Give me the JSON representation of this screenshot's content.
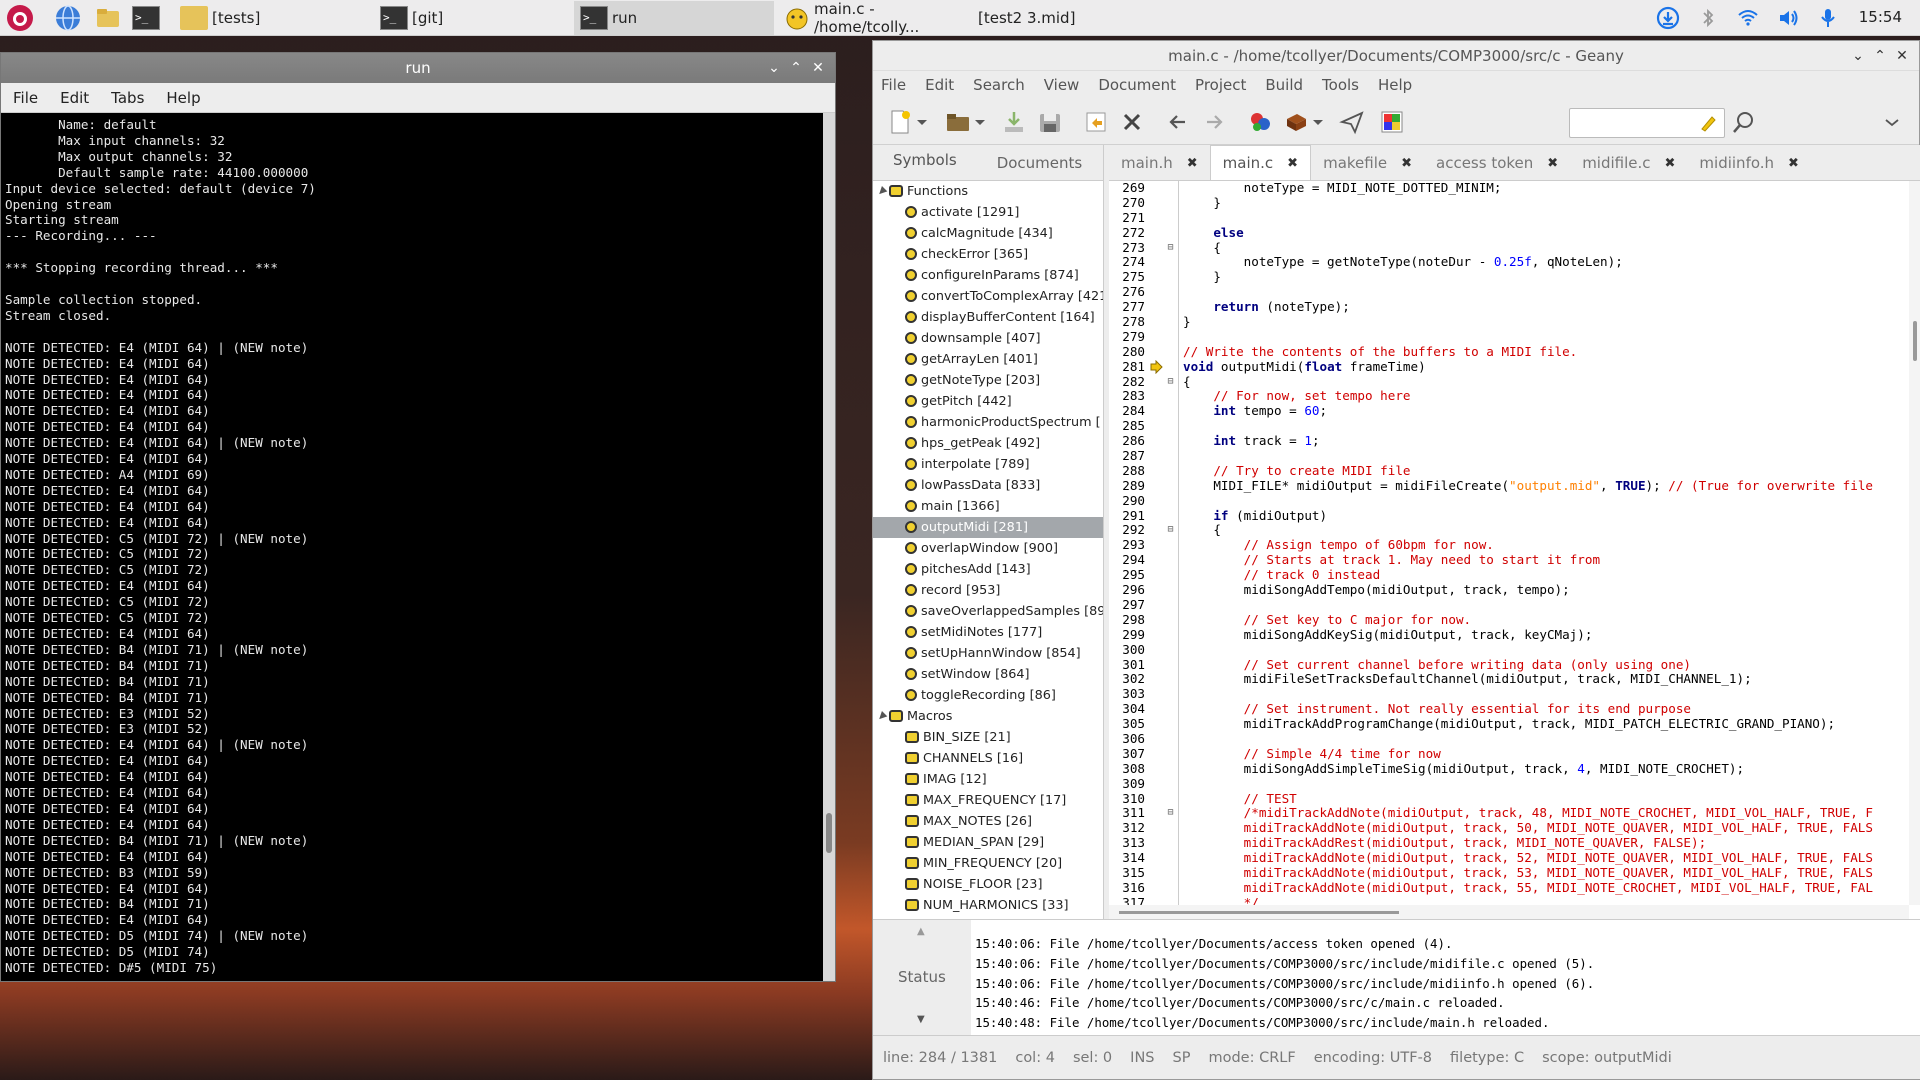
{
  "taskbar": {
    "buttons": [
      {
        "label": "[tests]"
      },
      {
        "label": "[git]"
      },
      {
        "label": "run"
      },
      {
        "label": "main.c - /home/tcolly..."
      },
      {
        "label": "[test2 3.mid]"
      }
    ],
    "clock": "15:54"
  },
  "terminal": {
    "title": "run",
    "menu": [
      "File",
      "Edit",
      "Tabs",
      "Help"
    ],
    "lines": [
      "       Name: default",
      "       Max input channels: 32",
      "       Max output channels: 32",
      "       Default sample rate: 44100.000000",
      "Input device selected: default (device 7)",
      "Opening stream",
      "Starting stream",
      "--- Recording... ---",
      "",
      "*** Stopping recording thread... ***",
      "",
      "Sample collection stopped.",
      "Stream closed.",
      "",
      "NOTE DETECTED: E4 (MIDI 64) | (NEW note)",
      "NOTE DETECTED: E4 (MIDI 64)",
      "NOTE DETECTED: E4 (MIDI 64)",
      "NOTE DETECTED: E4 (MIDI 64)",
      "NOTE DETECTED: E4 (MIDI 64)",
      "NOTE DETECTED: E4 (MIDI 64)",
      "NOTE DETECTED: E4 (MIDI 64) | (NEW note)",
      "NOTE DETECTED: E4 (MIDI 64)",
      "NOTE DETECTED: A4 (MIDI 69)",
      "NOTE DETECTED: E4 (MIDI 64)",
      "NOTE DETECTED: E4 (MIDI 64)",
      "NOTE DETECTED: E4 (MIDI 64)",
      "NOTE DETECTED: C5 (MIDI 72) | (NEW note)",
      "NOTE DETECTED: C5 (MIDI 72)",
      "NOTE DETECTED: C5 (MIDI 72)",
      "NOTE DETECTED: E4 (MIDI 64)",
      "NOTE DETECTED: C5 (MIDI 72)",
      "NOTE DETECTED: C5 (MIDI 72)",
      "NOTE DETECTED: E4 (MIDI 64)",
      "NOTE DETECTED: B4 (MIDI 71) | (NEW note)",
      "NOTE DETECTED: B4 (MIDI 71)",
      "NOTE DETECTED: B4 (MIDI 71)",
      "NOTE DETECTED: B4 (MIDI 71)",
      "NOTE DETECTED: E3 (MIDI 52)",
      "NOTE DETECTED: E3 (MIDI 52)",
      "NOTE DETECTED: E4 (MIDI 64) | (NEW note)",
      "NOTE DETECTED: E4 (MIDI 64)",
      "NOTE DETECTED: E4 (MIDI 64)",
      "NOTE DETECTED: E4 (MIDI 64)",
      "NOTE DETECTED: E4 (MIDI 64)",
      "NOTE DETECTED: E4 (MIDI 64)",
      "NOTE DETECTED: B4 (MIDI 71) | (NEW note)",
      "NOTE DETECTED: E4 (MIDI 64)",
      "NOTE DETECTED: B3 (MIDI 59)",
      "NOTE DETECTED: E4 (MIDI 64)",
      "NOTE DETECTED: B4 (MIDI 71)",
      "NOTE DETECTED: E4 (MIDI 64)",
      "NOTE DETECTED: D5 (MIDI 74) | (NEW note)",
      "NOTE DETECTED: D5 (MIDI 74)",
      "NOTE DETECTED: D#5 (MIDI 75)"
    ]
  },
  "geany": {
    "title": "main.c - /home/tcollyer/Documents/COMP3000/src/c - Geany",
    "menu": [
      "File",
      "Edit",
      "Search",
      "View",
      "Document",
      "Project",
      "Build",
      "Tools",
      "Help"
    ],
    "side_tabs": [
      "Symbols",
      "Documents"
    ],
    "tree": [
      {
        "kind": "group",
        "label": "Functions"
      },
      {
        "kind": "item",
        "label": "activate [1291]"
      },
      {
        "kind": "item",
        "label": "calcMagnitude [434]"
      },
      {
        "kind": "item",
        "label": "checkError [365]"
      },
      {
        "kind": "item",
        "label": "configureInParams [874]"
      },
      {
        "kind": "item",
        "label": "convertToComplexArray [421"
      },
      {
        "kind": "item",
        "label": "displayBufferContent [164]"
      },
      {
        "kind": "item",
        "label": "downsample [407]"
      },
      {
        "kind": "item",
        "label": "getArrayLen [401]"
      },
      {
        "kind": "item",
        "label": "getNoteType [203]"
      },
      {
        "kind": "item",
        "label": "getPitch [442]"
      },
      {
        "kind": "item",
        "label": "harmonicProductSpectrum ["
      },
      {
        "kind": "item",
        "label": "hps_getPeak [492]"
      },
      {
        "kind": "item",
        "label": "interpolate [789]"
      },
      {
        "kind": "item",
        "label": "lowPassData [833]"
      },
      {
        "kind": "item",
        "label": "main [1366]"
      },
      {
        "kind": "item",
        "label": "outputMidi [281]",
        "selected": true
      },
      {
        "kind": "item",
        "label": "overlapWindow [900]"
      },
      {
        "kind": "item",
        "label": "pitchesAdd [143]"
      },
      {
        "kind": "item",
        "label": "record [953]"
      },
      {
        "kind": "item",
        "label": "saveOverlappedSamples [89"
      },
      {
        "kind": "item",
        "label": "setMidiNotes [177]"
      },
      {
        "kind": "item",
        "label": "setUpHannWindow [854]"
      },
      {
        "kind": "item",
        "label": "setWindow [864]"
      },
      {
        "kind": "item",
        "label": "toggleRecording [86]"
      },
      {
        "kind": "group",
        "label": "Macros"
      },
      {
        "kind": "macro",
        "label": "BIN_SIZE [21]"
      },
      {
        "kind": "macro",
        "label": "CHANNELS [16]"
      },
      {
        "kind": "macro",
        "label": "IMAG [12]"
      },
      {
        "kind": "macro",
        "label": "MAX_FREQUENCY [17]"
      },
      {
        "kind": "macro",
        "label": "MAX_NOTES [26]"
      },
      {
        "kind": "macro",
        "label": "MEDIAN_SPAN [29]"
      },
      {
        "kind": "macro",
        "label": "MIN_FREQUENCY [20]"
      },
      {
        "kind": "macro",
        "label": "NOISE_FLOOR [23]"
      },
      {
        "kind": "macro",
        "label": "NUM_HARMONICS [33]"
      }
    ],
    "tabs": [
      {
        "label": "main.h",
        "active": false
      },
      {
        "label": "main.c",
        "active": true
      },
      {
        "label": "makefile",
        "active": false
      },
      {
        "label": "access token",
        "active": false
      },
      {
        "label": "midifile.c",
        "active": false
      },
      {
        "label": "midiinfo.h",
        "active": false
      }
    ],
    "code": [
      {
        "n": "269",
        "t": "        noteType = MIDI_NOTE_DOTTED_MINIM;"
      },
      {
        "n": "270",
        "t": "    }"
      },
      {
        "n": "271",
        "t": ""
      },
      {
        "n": "272",
        "t": "    else"
      },
      {
        "n": "273",
        "t": "    {",
        "fold": true
      },
      {
        "n": "274",
        "t": "        noteType = getNoteType(noteDur - 0.25f, qNoteLen);"
      },
      {
        "n": "275",
        "t": "    }"
      },
      {
        "n": "276",
        "t": ""
      },
      {
        "n": "277",
        "t": "    return (noteType);"
      },
      {
        "n": "278",
        "t": "}"
      },
      {
        "n": "279",
        "t": ""
      },
      {
        "n": "280",
        "t": "// Write the contents of the buffers to a MIDI file."
      },
      {
        "n": "281",
        "t": "void outputMidi(float frameTime)",
        "marker": true
      },
      {
        "n": "282",
        "t": "{",
        "fold": true
      },
      {
        "n": "283",
        "t": "    // For now, set tempo here"
      },
      {
        "n": "284",
        "t": "    int tempo = 60;"
      },
      {
        "n": "285",
        "t": ""
      },
      {
        "n": "286",
        "t": "    int track = 1;"
      },
      {
        "n": "287",
        "t": ""
      },
      {
        "n": "288",
        "t": "    // Try to create MIDI file"
      },
      {
        "n": "289",
        "t": "    MIDI_FILE* midiOutput = midiFileCreate(\"output.mid\", TRUE); // (True for overwrite file"
      },
      {
        "n": "290",
        "t": ""
      },
      {
        "n": "291",
        "t": "    if (midiOutput)"
      },
      {
        "n": "292",
        "t": "    {",
        "fold": true
      },
      {
        "n": "293",
        "t": "        // Assign tempo of 60bpm for now."
      },
      {
        "n": "294",
        "t": "        // Starts at track 1. May need to start it from"
      },
      {
        "n": "295",
        "t": "        // track 0 instead"
      },
      {
        "n": "296",
        "t": "        midiSongAddTempo(midiOutput, track, tempo);"
      },
      {
        "n": "297",
        "t": ""
      },
      {
        "n": "298",
        "t": "        // Set key to C major for now."
      },
      {
        "n": "299",
        "t": "        midiSongAddKeySig(midiOutput, track, keyCMaj);"
      },
      {
        "n": "300",
        "t": ""
      },
      {
        "n": "301",
        "t": "        // Set current channel before writing data (only using one)"
      },
      {
        "n": "302",
        "t": "        midiFileSetTracksDefaultChannel(midiOutput, track, MIDI_CHANNEL_1);"
      },
      {
        "n": "303",
        "t": ""
      },
      {
        "n": "304",
        "t": "        // Set instrument. Not really essential for its end purpose"
      },
      {
        "n": "305",
        "t": "        midiTrackAddProgramChange(midiOutput, track, MIDI_PATCH_ELECTRIC_GRAND_PIANO);"
      },
      {
        "n": "306",
        "t": ""
      },
      {
        "n": "307",
        "t": "        // Simple 4/4 time for now"
      },
      {
        "n": "308",
        "t": "        midiSongAddSimpleTimeSig(midiOutput, track, 4, MIDI_NOTE_CROCHET);"
      },
      {
        "n": "309",
        "t": ""
      },
      {
        "n": "310",
        "t": "        // TEST"
      },
      {
        "n": "311",
        "t": "        /*midiTrackAddNote(midiOutput, track, 48, MIDI_NOTE_CROCHET, MIDI_VOL_HALF, TRUE, F",
        "fold": true
      },
      {
        "n": "312",
        "t": "        midiTrackAddNote(midiOutput, track, 50, MIDI_NOTE_QUAVER, MIDI_VOL_HALF, TRUE, FALS"
      },
      {
        "n": "313",
        "t": "        midiTrackAddRest(midiOutput, track, MIDI_NOTE_QUAVER, FALSE);"
      },
      {
        "n": "314",
        "t": "        midiTrackAddNote(midiOutput, track, 52, MIDI_NOTE_QUAVER, MIDI_VOL_HALF, TRUE, FALS"
      },
      {
        "n": "315",
        "t": "        midiTrackAddNote(midiOutput, track, 53, MIDI_NOTE_QUAVER, MIDI_VOL_HALF, TRUE, FALS"
      },
      {
        "n": "316",
        "t": "        midiTrackAddNote(midiOutput, track, 55, MIDI_NOTE_CROCHET, MIDI_VOL_HALF, TRUE, FAL"
      },
      {
        "n": "317",
        "t": "        */"
      }
    ],
    "messages": {
      "status_label": "Status",
      "log": [
        "15:40:06: File /home/tcollyer/Documents/access token opened (4).",
        "15:40:06: File /home/tcollyer/Documents/COMP3000/src/include/midifile.c opened (5).",
        "15:40:06: File /home/tcollyer/Documents/COMP3000/src/include/midiinfo.h opened (6).",
        "15:40:46: File /home/tcollyer/Documents/COMP3000/src/c/main.c reloaded.",
        "15:40:48: File /home/tcollyer/Documents/COMP3000/src/include/main.h reloaded."
      ]
    },
    "statusbar": {
      "line": "line: 284 / 1381",
      "col": "col: 4",
      "sel": "sel: 0",
      "ins": "INS",
      "sp": "SP",
      "mode": "mode: CRLF",
      "encoding": "encoding: UTF-8",
      "filetype": "filetype: C",
      "scope": "scope: outputMidi"
    }
  }
}
